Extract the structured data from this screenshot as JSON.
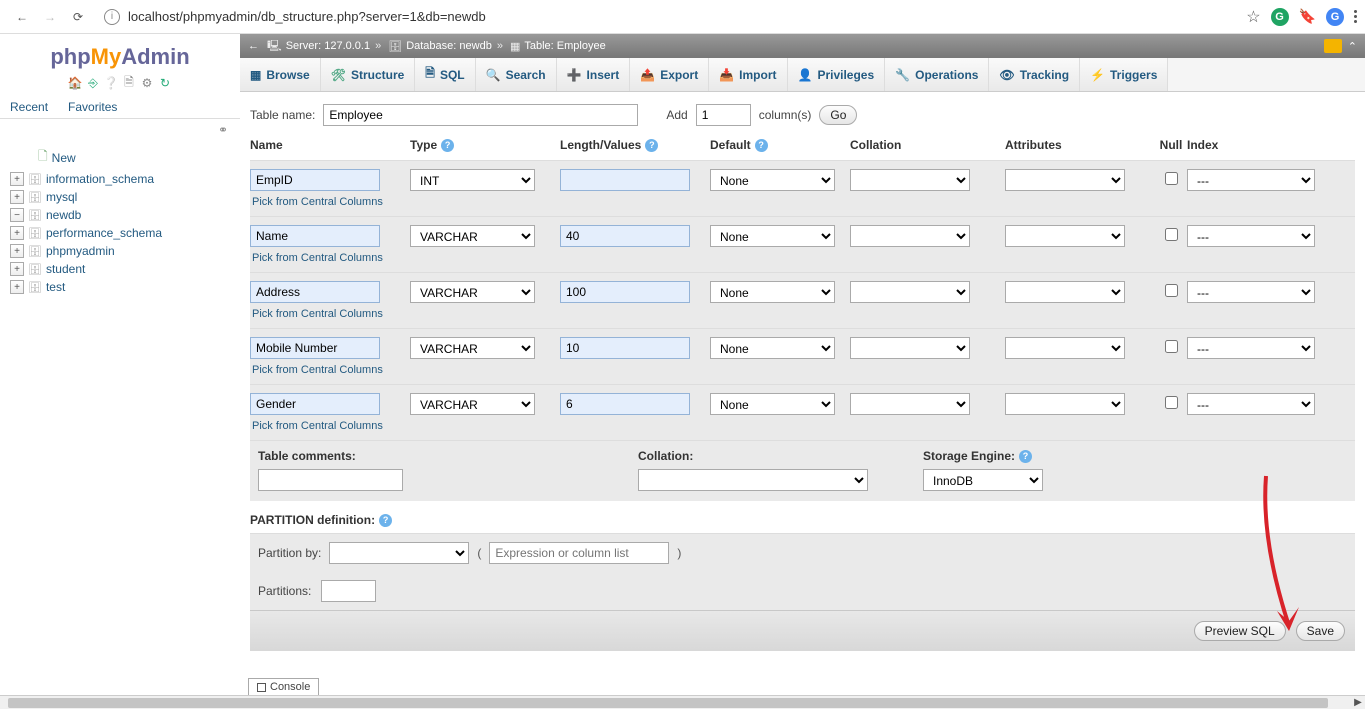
{
  "browser": {
    "url": "localhost/phpmyadmin/db_structure.php?server=1&db=newdb",
    "right_badge_1": "G",
    "right_badge_2": "G"
  },
  "logo": {
    "php": "php",
    "my": "My",
    "admin": "Admin"
  },
  "nav_tabs": {
    "recent": "Recent",
    "favorites": "Favorites"
  },
  "tree": {
    "new_label": "New",
    "dbs": [
      "information_schema",
      "mysql",
      "newdb",
      "performance_schema",
      "phpmyadmin",
      "student",
      "test"
    ]
  },
  "breadcrumb": {
    "server_label": "Server:",
    "server_val": "127.0.0.1",
    "db_label": "Database:",
    "db_val": "newdb",
    "table_label": "Table:",
    "table_val": "Employee"
  },
  "tabs": {
    "browse": "Browse",
    "structure": "Structure",
    "sql": "SQL",
    "search": "Search",
    "insert": "Insert",
    "export": "Export",
    "import": "Import",
    "privileges": "Privileges",
    "operations": "Operations",
    "tracking": "Tracking",
    "triggers": "Triggers"
  },
  "form": {
    "table_name_label": "Table name:",
    "table_name": "Employee",
    "add_label": "Add",
    "add_n": "1",
    "columns_label": "column(s)",
    "go_label": "Go"
  },
  "headers": {
    "name": "Name",
    "type": "Type",
    "length": "Length/Values",
    "default": "Default",
    "collation": "Collation",
    "attributes": "Attributes",
    "null": "Null",
    "index": "Index"
  },
  "pick_text": "Pick from Central Columns",
  "cols": [
    {
      "name": "EmpID",
      "type": "INT",
      "len": "",
      "def": "None",
      "idx": "---"
    },
    {
      "name": "Name",
      "type": "VARCHAR",
      "len": "40",
      "def": "None",
      "idx": "---"
    },
    {
      "name": "Address",
      "type": "VARCHAR",
      "len": "100",
      "def": "None",
      "idx": "---"
    },
    {
      "name": "Mobile Number",
      "type": "VARCHAR",
      "len": "10",
      "def": "None",
      "idx": "---"
    },
    {
      "name": "Gender",
      "type": "VARCHAR",
      "len": "6",
      "def": "None",
      "idx": "---"
    }
  ],
  "bottom": {
    "comments_label": "Table comments:",
    "collation_label": "Collation:",
    "engine_label": "Storage Engine:",
    "engine_val": "InnoDB",
    "partition_def_label": "PARTITION definition:",
    "partition_by_label": "Partition by:",
    "expr_placeholder": "Expression or column list",
    "partitions_label": "Partitions:"
  },
  "buttons": {
    "preview": "Preview SQL",
    "save": "Save"
  },
  "console": "Console"
}
